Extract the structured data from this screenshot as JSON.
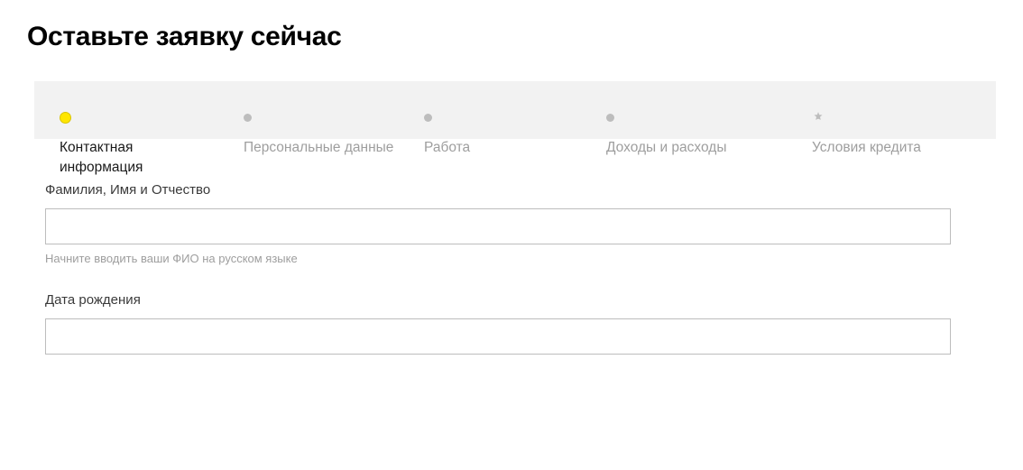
{
  "header": {
    "title": "Оставьте заявку сейчас"
  },
  "stepper": {
    "steps": [
      {
        "label": "Контактная\nинформация",
        "active": true,
        "icon": "dot"
      },
      {
        "label": "Персональные данные",
        "active": false,
        "icon": "dot"
      },
      {
        "label": "Работа",
        "active": false,
        "icon": "dot"
      },
      {
        "label": "Доходы и расходы",
        "active": false,
        "icon": "dot"
      },
      {
        "label": "Условия кредита",
        "active": false,
        "icon": "star"
      }
    ]
  },
  "form": {
    "fullname": {
      "label": "Фамилия, Имя и Отчество",
      "value": "",
      "hint": "Начните вводить ваши ФИО на русском языке"
    },
    "birthdate": {
      "label": "Дата рождения",
      "value": ""
    }
  },
  "colors": {
    "accent": "#ffe600",
    "muted": "#9e9e9e",
    "border": "#bdbdbd",
    "stepper_bg": "#f2f2f2"
  }
}
